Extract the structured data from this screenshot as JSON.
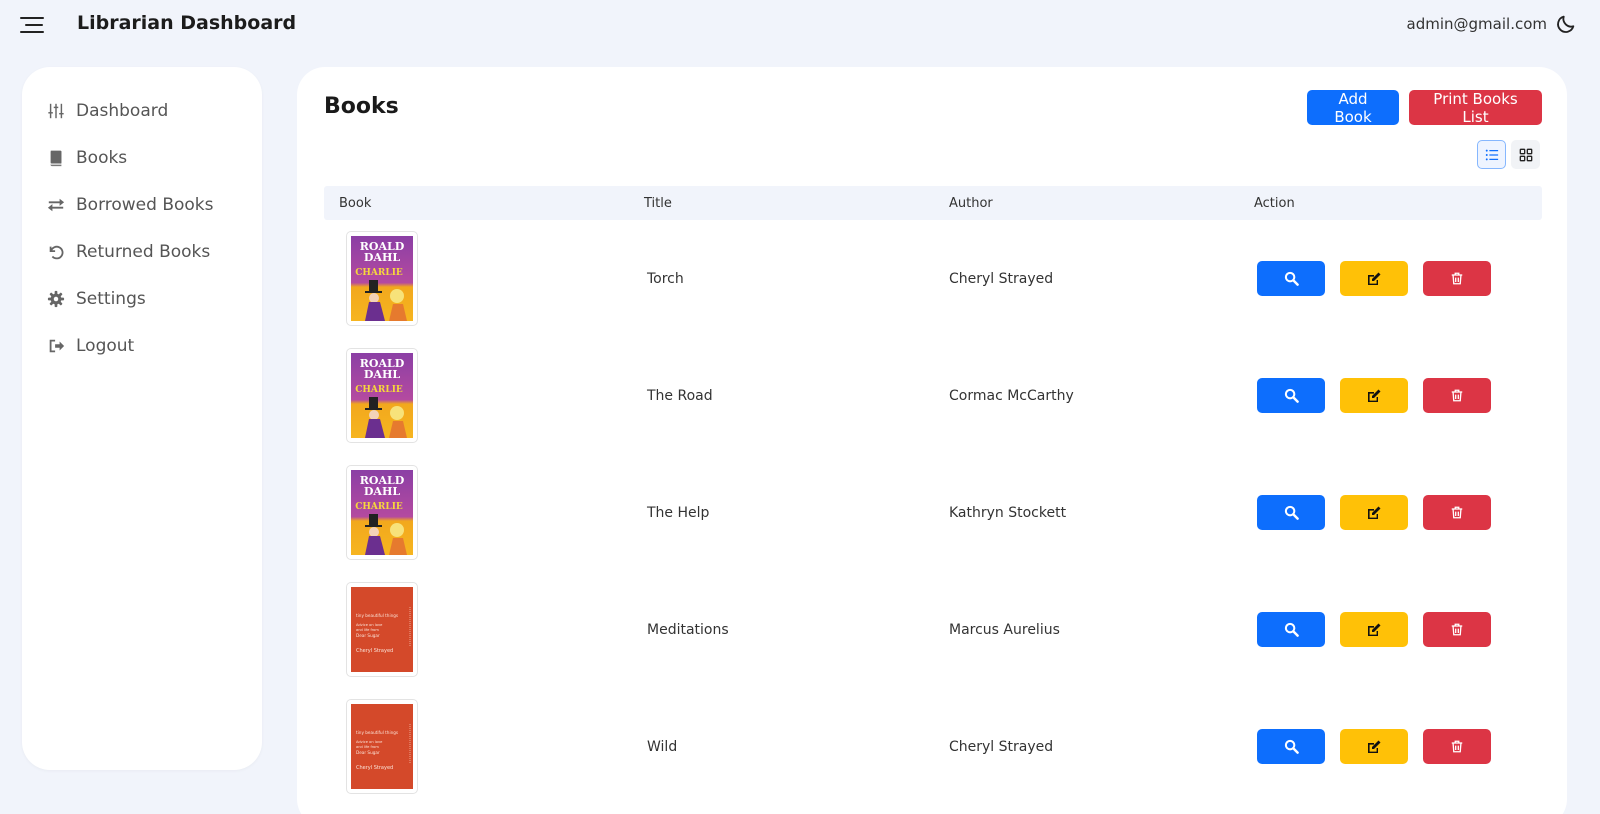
{
  "header": {
    "title": "Librarian Dashboard",
    "user_email": "admin@gmail.com"
  },
  "sidebar": {
    "items": [
      {
        "label": "Dashboard",
        "icon": "sliders-icon"
      },
      {
        "label": "Books",
        "icon": "book-icon"
      },
      {
        "label": "Borrowed Books",
        "icon": "exchange-icon"
      },
      {
        "label": "Returned Books",
        "icon": "undo-icon"
      },
      {
        "label": "Settings",
        "icon": "gear-icon"
      },
      {
        "label": "Logout",
        "icon": "logout-icon"
      }
    ]
  },
  "main": {
    "title": "Books",
    "add_label": "Add Book",
    "print_label": "Print Books List",
    "columns": [
      "Book",
      "Title",
      "Author",
      "Action"
    ],
    "rows": [
      {
        "title": "Torch",
        "author": "Cheryl Strayed",
        "cover": "roald-dahl-charlie"
      },
      {
        "title": "The Road",
        "author": "Cormac McCarthy",
        "cover": "roald-dahl-charlie"
      },
      {
        "title": "The Help",
        "author": "Kathryn Stockett",
        "cover": "roald-dahl-charlie"
      },
      {
        "title": "Meditations",
        "author": "Marcus Aurelius",
        "cover": "tiny-beautiful-things"
      },
      {
        "title": "Wild",
        "author": "Cheryl Strayed",
        "cover": "tiny-beautiful-things"
      }
    ]
  },
  "colors": {
    "primary": "#0d6efd",
    "danger": "#dc3545",
    "warning": "#ffc107",
    "background": "#f1f4fb"
  },
  "covers": {
    "roald-dahl-charlie": {
      "author": "ROALD DAHL",
      "title": "CHARLIE"
    },
    "tiny-beautiful-things": {
      "line1": "tiny beautiful things",
      "line2": "Advice on love and life from Dear Sugar",
      "author": "Cheryl Strayed"
    }
  }
}
